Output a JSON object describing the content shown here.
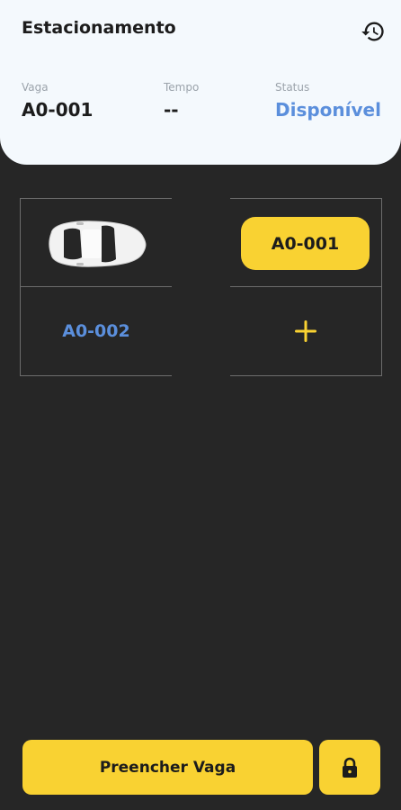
{
  "header": {
    "title": "Estacionamento",
    "history_icon": "history-icon",
    "vaga_label": "Vaga",
    "vaga_value": "A0-001",
    "tempo_label": "Tempo",
    "tempo_value": "--",
    "status_label": "Status",
    "status_value": "Disponível"
  },
  "grid": {
    "occupied_icon": "car-icon",
    "selected_spot": "A0-001",
    "free_spot": "A0-002",
    "add_icon": "plus-icon"
  },
  "footer": {
    "fill_button_label": "Preencher Vaga",
    "lock_icon": "lock-icon"
  },
  "colors": {
    "background": "#262626",
    "header_bg": "#f4f9fd",
    "accent_yellow": "#f9d232",
    "accent_blue": "#5b8fdc",
    "grid_line": "#6c6c6c"
  }
}
